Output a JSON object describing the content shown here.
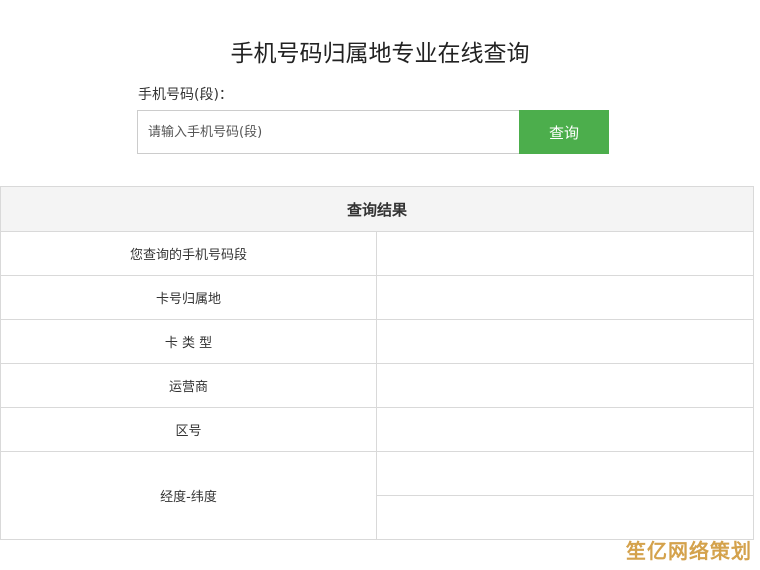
{
  "header": {
    "title": "手机号码归属地专业在线查询"
  },
  "search": {
    "label": "手机号码(段)：",
    "placeholder": "请输入手机号码(段)",
    "value": "",
    "button_label": "查询"
  },
  "results": {
    "header": "查询结果",
    "rows": [
      {
        "label": "您查询的手机号码段",
        "value": ""
      },
      {
        "label": "卡号归属地",
        "value": ""
      },
      {
        "label": "卡 类 型",
        "value": ""
      },
      {
        "label": "运营商",
        "value": ""
      },
      {
        "label": "区号",
        "value": ""
      },
      {
        "label": "经度-纬度",
        "value": "",
        "value2": ""
      }
    ]
  },
  "watermark": "笙亿网络策划",
  "colors": {
    "accent": "#4cae4c",
    "table_header_bg": "#f4f4f4",
    "border": "#d9d9d9",
    "watermark": "#d4a24c"
  }
}
